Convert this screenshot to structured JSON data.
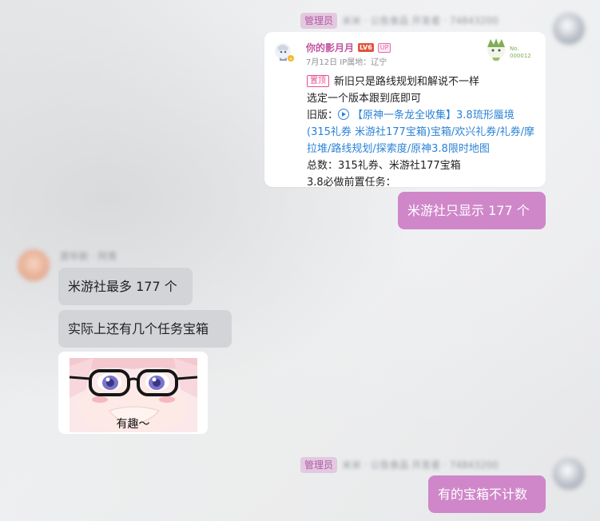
{
  "messages": {
    "top_header": {
      "role_badge": "管理员",
      "blurred_name": "米米 · 公告食品 开发者 · 74843200"
    },
    "share_card": {
      "author": "你的影月月",
      "level": "LV6",
      "up_badge": "UP",
      "meta": "7月12日 IP属地：辽宁",
      "badge_no": "No.",
      "badge_num": "000012",
      "pin_label": "置顶",
      "line1": "新旧只是路线规划和解说不一样",
      "line2": "选定一个版本跟到底即可",
      "old_label": "旧版：",
      "link_line1": "【原神一条龙全收集】3.8琉形蜃境",
      "link_line2": "(315礼券 米游社177宝箱)宝箱/欢兴礼券/礼券/摩",
      "link_line3": "拉堆/路线规划/探索度/原神3.8限时地图",
      "total_line": "总数：315礼券、米游社177宝箱",
      "prereq_line": "3.8必做前置任务："
    },
    "bubble_me_1": "米游社只显示 177 个",
    "other_header": {
      "blurred_name": "原毕新 · 阿青"
    },
    "other_bubble_1": "米游社最多 177 个",
    "other_bubble_2": "实际上还有几个任务宝箱",
    "sticker_caption": "有趣～",
    "bottom_header": {
      "role_badge": "管理员",
      "blurred_name": "米米 · 公告食品 开发者 · 74843200"
    },
    "bubble_me_2": "有的宝箱不计数"
  },
  "colors": {
    "my_bubble": "#cf87c9",
    "other_bubble": "#d3d4d8",
    "link": "#2b83d6",
    "author": "#c2549f"
  }
}
